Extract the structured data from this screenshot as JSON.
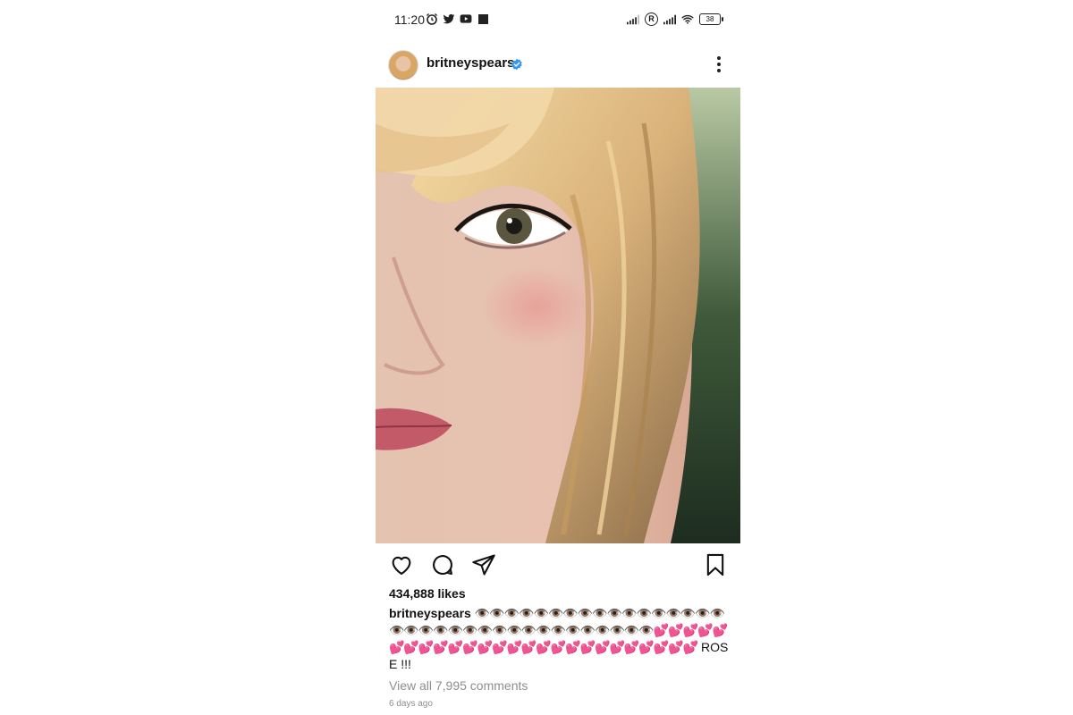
{
  "status_bar": {
    "time": "11:20",
    "battery": "38",
    "left_icons": [
      "alarm-icon",
      "twitter-icon",
      "youtube-icon",
      "square-icon"
    ],
    "right_icons": [
      "signal-icon",
      "registered-icon",
      "signal-icon",
      "wifi-icon",
      "battery-icon"
    ]
  },
  "post": {
    "username": "britneyspears",
    "verified": true,
    "likes": "434,888 likes",
    "caption_user": "britneyspears",
    "caption_eyes": "👁️👁️👁️👁️👁️👁️👁️👁️👁️👁️👁️👁️👁️👁️👁️👁️👁️👁️👁️👁️👁️👁️👁️👁️👁️👁️👁️👁️👁️👁️👁️👁️👁️👁️👁️",
    "caption_hearts": "💕💕💕💕💕💕💕💕💕💕💕💕💕💕💕💕💕💕💕💕💕💕💕💕💕💕",
    "caption_text": " ROSE !!!",
    "view_comments": "View all 7,995 comments",
    "time_ago": "6 days ago"
  },
  "colors": {
    "verified_blue": "#3897f0",
    "secondary_text": "#8e8e8e"
  }
}
